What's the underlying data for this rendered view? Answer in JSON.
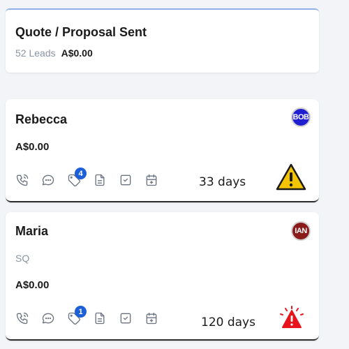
{
  "stage": {
    "title": "Quote / Proposal Sent",
    "count": "52 Leads",
    "value": "A$0.00"
  },
  "colors": {
    "badge": "#1c5fd8",
    "warn_yellow": "#f5c400",
    "alert_red": "#e8141c",
    "icon_gray": "#6b7280"
  },
  "cards": [
    {
      "name": "Rebecca",
      "amount": "A$0.00",
      "avatar": {
        "initials": "BOB",
        "color": "#1f1fd0"
      },
      "icons": [
        "phone-icon",
        "chat-icon",
        "tag-icon",
        "document-icon",
        "checkbox-icon",
        "calendar-icon"
      ],
      "badge": "4",
      "days": "33 days",
      "status_icon": "warning-yellow-icon"
    },
    {
      "name": "Maria",
      "sub": "SQ",
      "amount": "A$0.00",
      "avatar": {
        "initials": "IAN",
        "color": "#8b1a1a"
      },
      "icons": [
        "phone-icon",
        "chat-icon",
        "tag-icon",
        "document-icon",
        "checkbox-icon",
        "calendar-icon"
      ],
      "badge": "1",
      "days": "120 days",
      "status_icon": "alert-red-icon"
    }
  ]
}
